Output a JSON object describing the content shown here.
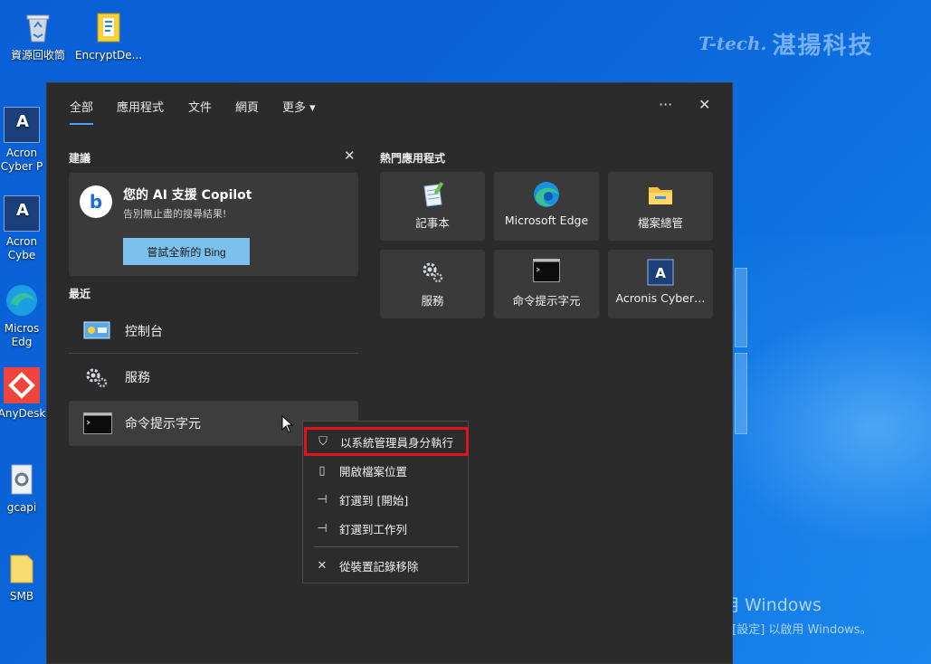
{
  "desktop": {
    "icons": [
      {
        "label": "資源回收筒",
        "icon": "recycle-bin-icon"
      },
      {
        "label": "EncryptDe...",
        "icon": "encrypt-app-icon"
      }
    ],
    "left_icons": [
      {
        "label": "Acron\nCyber P",
        "icon": "acronis-icon"
      },
      {
        "label": "Acron\nCybe",
        "icon": "acronis-icon"
      },
      {
        "label": "Micros\nEdg",
        "icon": "edge-icon"
      },
      {
        "label": "AnyDesk",
        "icon": "anydesk-icon"
      },
      {
        "label": "gcapi",
        "icon": "gear-file-icon"
      },
      {
        "label": "SMB",
        "icon": "folder-icon"
      }
    ],
    "watermark": {
      "logo": "T-tech.",
      "text": "湛揚科技"
    },
    "activation": {
      "line1": "啟用 Windows",
      "line2": "移至 [設定] 以啟用 Windows。"
    }
  },
  "panel": {
    "tabs": [
      {
        "label": "全部",
        "active": true
      },
      {
        "label": "應用程式"
      },
      {
        "label": "文件"
      },
      {
        "label": "網頁"
      },
      {
        "label": "更多 ▾"
      }
    ],
    "more_glyph": "···",
    "close_glyph": "✕",
    "suggestions": {
      "title": "建議",
      "dismiss_glyph": "✕",
      "card_title": "您的 AI 支援 Copilot",
      "card_subtitle": "告別無止盡的搜尋結果!",
      "card_button": "嘗試全新的 Bing"
    },
    "recent": {
      "title": "最近",
      "items": [
        {
          "label": "控制台",
          "icon": "control-panel-icon"
        },
        {
          "label": "服務",
          "icon": "services-gear-icon"
        },
        {
          "label": "命令提示字元",
          "icon": "cmd-icon"
        }
      ]
    },
    "top_apps": {
      "title": "熱門應用程式",
      "items": [
        {
          "label": "記事本",
          "icon": "notepad-icon"
        },
        {
          "label": "Microsoft Edge",
          "icon": "edge-icon"
        },
        {
          "label": "檔案總管",
          "icon": "file-explorer-icon"
        },
        {
          "label": "服務",
          "icon": "services-gear-icon"
        },
        {
          "label": "命令提示字元",
          "icon": "cmd-icon"
        },
        {
          "label": "Acronis Cyber…",
          "icon": "acronis-icon"
        }
      ]
    }
  },
  "context_menu": {
    "items": [
      {
        "label": "以系統管理員身分執行",
        "icon": "shield-icon"
      },
      {
        "label": "開啟檔案位置",
        "icon": "open-folder-icon"
      },
      {
        "label": "釘選到 [開始]",
        "icon": "pin-icon"
      },
      {
        "label": "釘選到工作列",
        "icon": "pin-icon"
      },
      {
        "label": "從裝置記錄移除",
        "icon": "remove-icon"
      }
    ]
  }
}
